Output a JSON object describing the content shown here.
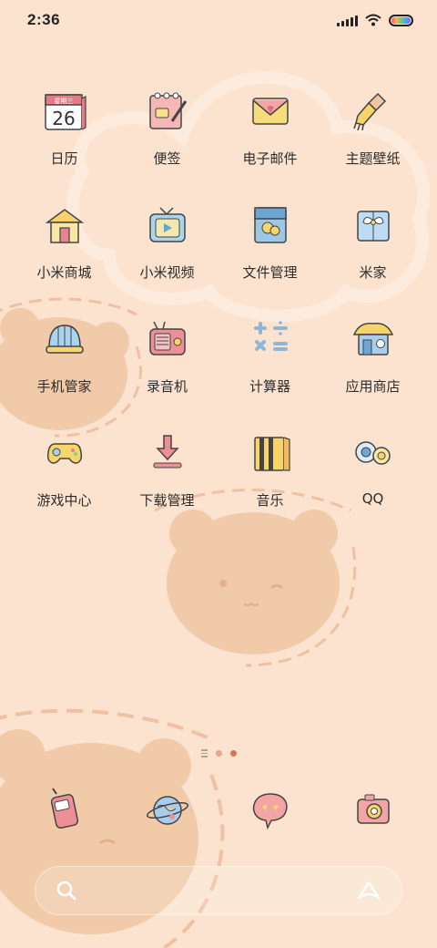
{
  "status_bar": {
    "time": "2:36",
    "icons": [
      "signal-icon",
      "wifi-icon",
      "battery-icon"
    ],
    "battery_colors": [
      "#ff4f7a",
      "#ffb33a",
      "#62d36f",
      "#3aa7ff",
      "#9b5bff"
    ]
  },
  "apps": [
    {
      "label": "日历",
      "icon": "calendar-icon",
      "calendar_weekday": "星期三",
      "calendar_day": "26"
    },
    {
      "label": "便签",
      "icon": "notes-icon"
    },
    {
      "label": "电子邮件",
      "icon": "mail-icon"
    },
    {
      "label": "主题壁纸",
      "icon": "brush-icon"
    },
    {
      "label": "小米商城",
      "icon": "store-house-icon"
    },
    {
      "label": "小米视频",
      "icon": "tv-icon"
    },
    {
      "label": "文件管理",
      "icon": "folder-icon"
    },
    {
      "label": "米家",
      "icon": "gift-box-icon"
    },
    {
      "label": "手机管家",
      "icon": "helmet-icon"
    },
    {
      "label": "录音机",
      "icon": "radio-icon"
    },
    {
      "label": "计算器",
      "icon": "calculator-icon"
    },
    {
      "label": "应用商店",
      "icon": "app-store-house-icon"
    },
    {
      "label": "游戏中心",
      "icon": "gamepad-icon"
    },
    {
      "label": "下载管理",
      "icon": "download-icon"
    },
    {
      "label": "音乐",
      "icon": "music-icon"
    },
    {
      "label": "QQ",
      "icon": "qq-icon"
    }
  ],
  "page_indicator": {
    "pages": 2,
    "current": 2
  },
  "dock": [
    {
      "icon": "phone-icon"
    },
    {
      "icon": "browser-planet-icon"
    },
    {
      "icon": "message-bubble-icon"
    },
    {
      "icon": "camera-icon"
    }
  ],
  "search": {
    "left_icon": "search-icon",
    "right_icon": "assistant-icon"
  },
  "colors": {
    "background": "#fbe3cf",
    "bear": "#f1c9a8",
    "accent": "#d3765a"
  }
}
